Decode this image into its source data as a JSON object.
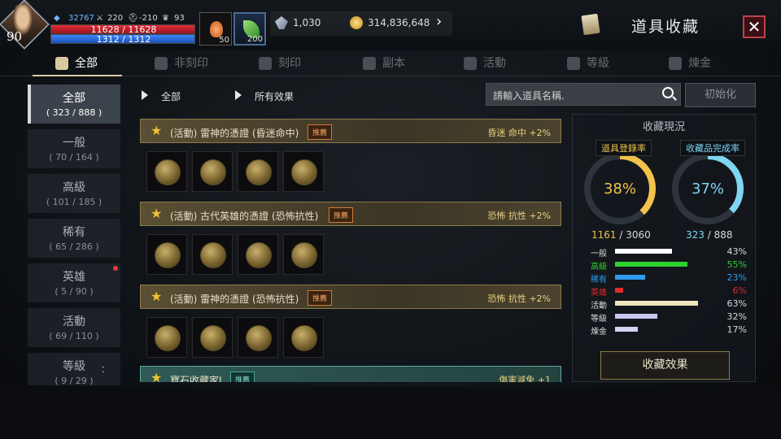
{
  "player": {
    "level": "90",
    "power": "32767",
    "stat_attack": "220",
    "stat_defense": "-210",
    "stat_trophy": "93",
    "hp_text": "11628 / 11628",
    "mp_text": "1312 / 1312",
    "potion_count": "50",
    "herb_count": "200"
  },
  "currency": {
    "gem": "1,030",
    "gold": "314,836,648"
  },
  "header": {
    "title": "道具收藏",
    "close": "✕"
  },
  "tabs": [
    {
      "label": "全部"
    },
    {
      "label": "非刻印"
    },
    {
      "label": "刻印"
    },
    {
      "label": "副本"
    },
    {
      "label": "活動"
    },
    {
      "label": "等級"
    },
    {
      "label": "煉金"
    }
  ],
  "categories": [
    {
      "name": "全部",
      "count": "( 323 / 888 )"
    },
    {
      "name": "一般",
      "count": "( 70 / 164 )"
    },
    {
      "name": "高級",
      "count": "( 101 / 185 )"
    },
    {
      "name": "稀有",
      "count": "( 65 / 286 )"
    },
    {
      "name": "英雄",
      "count": "( 5 / 90 )"
    },
    {
      "name": "活動",
      "count": "( 69 / 110 )"
    },
    {
      "name": "等級",
      "count": "( 9 / 29 )"
    }
  ],
  "filters": {
    "filter1": "全部",
    "filter2": "所有效果",
    "search_placeholder": "請輸入道具名稱.",
    "reset": "初始化"
  },
  "groups": [
    {
      "name": "(活動) 雷神的憑證 (昏迷命中)",
      "tag": "推薦",
      "effect": "昏迷 命中 +2%"
    },
    {
      "name": "(活動) 古代英雄的憑證 (恐怖抗性)",
      "tag": "推薦",
      "effect": "恐怖 抗性 +2%"
    },
    {
      "name": "(活動) 雷神的憑證 (恐怖抗性)",
      "tag": "推薦",
      "effect": "恐怖 抗性 +2%"
    },
    {
      "name": "寶石收藏家I",
      "tag": "推薦",
      "effect": "傷害減免 +1"
    }
  ],
  "collection": {
    "title": "收藏現況",
    "reg_label": "道具登錄率",
    "reg_pct": "38%",
    "reg_value": 0.38,
    "reg_have": "1161",
    "reg_total": "/ 3060",
    "comp_label": "收藏品完成率",
    "comp_pct": "37%",
    "comp_value": 0.37,
    "comp_have": "323",
    "comp_total": "/ 888",
    "rows": [
      {
        "label": "一般",
        "pct": "43%",
        "value": 0.43,
        "color": "#ffffff"
      },
      {
        "label": "高級",
        "pct": "55%",
        "value": 0.55,
        "color": "#2ed12e"
      },
      {
        "label": "稀有",
        "pct": "23%",
        "value": 0.23,
        "color": "#2e9cf0"
      },
      {
        "label": "英雄",
        "pct": "6%",
        "value": 0.06,
        "color": "#e02a2a"
      },
      {
        "label": "活動",
        "pct": "63%",
        "value": 0.63,
        "color": "#efe6c0"
      },
      {
        "label": "等級",
        "pct": "32%",
        "value": 0.32,
        "color": "#c9c6ee"
      },
      {
        "label": "煉金",
        "pct": "17%",
        "value": 0.17,
        "color": "#d6d2f2"
      }
    ],
    "effect_button": "收藏效果"
  }
}
